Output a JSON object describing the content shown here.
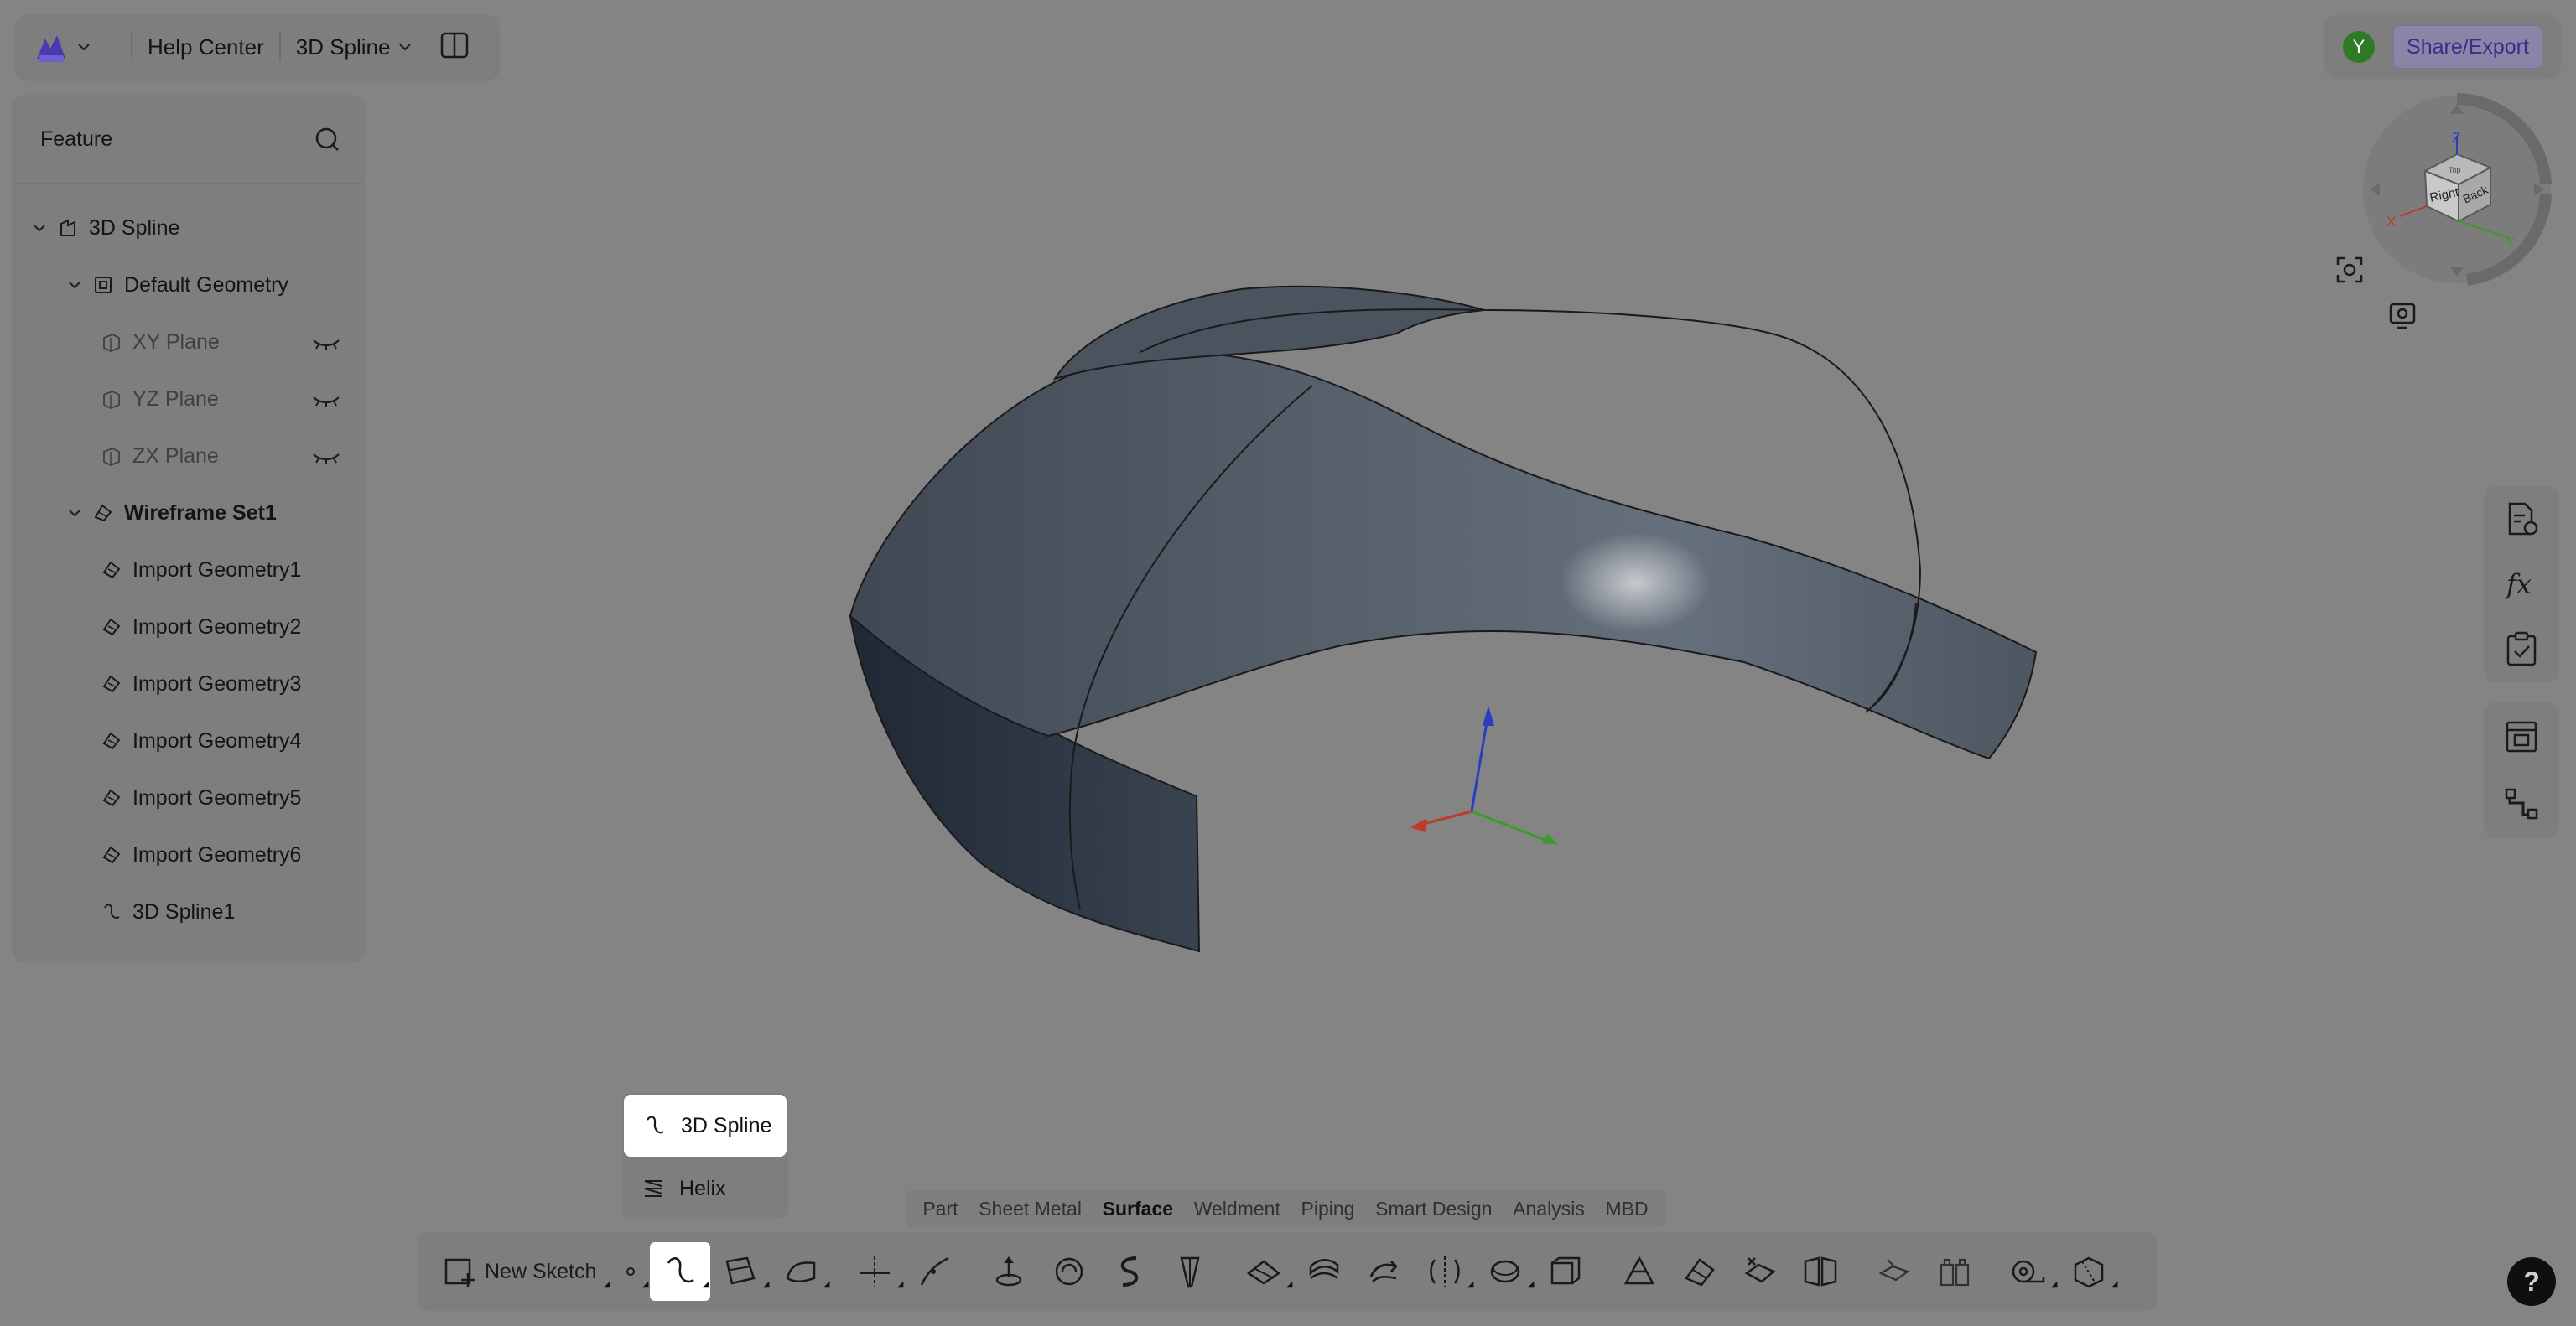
{
  "header": {
    "help_center": "Help Center",
    "document_name": "3D Spline"
  },
  "feature_panel": {
    "title": "Feature",
    "tree": [
      {
        "label": "3D Spline",
        "level": 0,
        "expanded": true,
        "icon": "part-icon"
      },
      {
        "label": "Default Geometry",
        "level": 1,
        "expanded": true,
        "icon": "default-geometry-icon"
      },
      {
        "label": "XY Plane",
        "level": 2,
        "hidden": true,
        "icon": "plane-icon"
      },
      {
        "label": "YZ Plane",
        "level": 2,
        "hidden": true,
        "icon": "plane-icon"
      },
      {
        "label": "ZX Plane",
        "level": 2,
        "hidden": true,
        "icon": "plane-icon"
      },
      {
        "label": "Wireframe Set1",
        "level": 1,
        "expanded": true,
        "icon": "wireframe-set-icon"
      },
      {
        "label": "Import Geometry1",
        "level": 2,
        "icon": "import-geometry-icon"
      },
      {
        "label": "Import Geometry2",
        "level": 2,
        "icon": "import-geometry-icon"
      },
      {
        "label": "Import Geometry3",
        "level": 2,
        "icon": "import-geometry-icon"
      },
      {
        "label": "Import Geometry4",
        "level": 2,
        "icon": "import-geometry-icon"
      },
      {
        "label": "Import Geometry5",
        "level": 2,
        "icon": "import-geometry-icon"
      },
      {
        "label": "Import Geometry6",
        "level": 2,
        "icon": "import-geometry-icon"
      },
      {
        "label": "3D Spline1",
        "level": 2,
        "icon": "spline-icon"
      }
    ]
  },
  "user": {
    "initial": "Y",
    "avatar_color": "#2f7a25"
  },
  "share_button": "Share/Export",
  "viewcube": {
    "faces": [
      "Right",
      "Back",
      "Top"
    ],
    "axes": [
      "X",
      "Y",
      "Z"
    ]
  },
  "dropdown": {
    "items": [
      {
        "label": "3D Spline",
        "icon": "spline-icon",
        "active": true
      },
      {
        "label": "Helix",
        "icon": "helix-icon",
        "active": false
      }
    ]
  },
  "mode_tabs": [
    {
      "label": "Part",
      "active": false
    },
    {
      "label": "Sheet Metal",
      "active": false
    },
    {
      "label": "Surface",
      "active": true
    },
    {
      "label": "Weldment",
      "active": false
    },
    {
      "label": "Piping",
      "active": false
    },
    {
      "label": "Smart Design",
      "active": false
    },
    {
      "label": "Analysis",
      "active": false
    },
    {
      "label": "MBD",
      "active": false
    }
  ],
  "toolbar": {
    "new_sketch": "New Sketch"
  },
  "help_label": "?",
  "colors": {
    "background": "#848484",
    "surface_fill": "#4f5863",
    "axis_x": "#c0392b",
    "axis_y": "#3f9a2e",
    "axis_z": "#2a3fbf",
    "accent": "#3c2a8c"
  }
}
